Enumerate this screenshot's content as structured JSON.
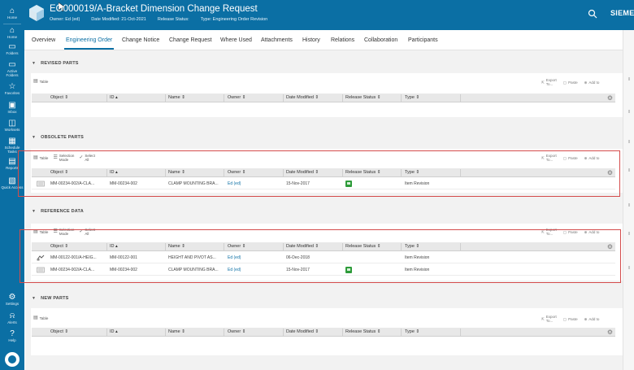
{
  "header": {
    "title": "EO000019/A-Bracket Dimension Change Request",
    "owner": "Owner: Ed (ed)",
    "date_modified": "Date Modified: 21-Oct-2021",
    "release_status": "Release Status:",
    "type": "Type: Engineering Order Revision",
    "brand": "SIEMENS"
  },
  "leftnav": {
    "items": [
      {
        "label": "Home",
        "icon": "home-icon"
      },
      {
        "label": "Home",
        "icon": "home-icon"
      },
      {
        "label": "Folders",
        "icon": "folder-icon"
      },
      {
        "label": "Active\nFolders",
        "icon": "folder-icon"
      },
      {
        "label": "Favorites",
        "icon": "star-icon"
      },
      {
        "label": "Inbox",
        "icon": "inbox-icon"
      },
      {
        "label": "Worksets",
        "icon": "workset-icon"
      },
      {
        "label": "Schedule\nTasks",
        "icon": "schedule-icon"
      },
      {
        "label": "Reports",
        "icon": "report-icon"
      },
      {
        "label": "Quick Access",
        "icon": "quick-access-icon"
      }
    ],
    "bottom_items": [
      {
        "label": "Settings",
        "icon": "gear-icon"
      },
      {
        "label": "Alerts",
        "icon": "bell-icon"
      },
      {
        "label": "Help",
        "icon": "help-icon"
      }
    ]
  },
  "tabs": [
    {
      "label": "Overview"
    },
    {
      "label": "Engineering Order"
    },
    {
      "label": "Change Notice"
    },
    {
      "label": "Change Request"
    },
    {
      "label": "Where Used"
    },
    {
      "label": "Attachments"
    },
    {
      "label": "History"
    },
    {
      "label": "Relations"
    },
    {
      "label": "Collaboration"
    },
    {
      "label": "Participants"
    }
  ],
  "columns": [
    "Object",
    "ID",
    "Name",
    "Owner",
    "Date Modified",
    "Release Status",
    "Type"
  ],
  "toolbar": {
    "table": "Table",
    "selection_mode": "Selection\nMode",
    "select_all": "Select\nAll",
    "export": "Export\nTo...",
    "paste": "Paste",
    "add_to": "Add to"
  },
  "sections": {
    "revised": {
      "title": "REVISED PARTS"
    },
    "obsolete": {
      "title": "OBSOLETE PARTS",
      "rows": [
        {
          "object": "MM-00234-002/A-CLA...",
          "id": "MM-00234-002",
          "name": "CLAMP MOUNTING BRA...",
          "owner": "Ed (ed)",
          "date": "15-Nov-2017",
          "type": "Item Revision"
        }
      ]
    },
    "reference": {
      "title": "REFERENCE DATA",
      "rows": [
        {
          "object": "MM-00122-001/A-HEIG...",
          "id": "MM-00122-001",
          "name": "HEIGHT AND PIVOT AS...",
          "owner": "Ed (ed)",
          "date": "06-Dec-2018",
          "type": "Item Revision"
        },
        {
          "object": "MM-00234-002/A-CLA...",
          "id": "MM-00234-002",
          "name": "CLAMP MOUNTING BRA...",
          "owner": "Ed (ed)",
          "date": "15-Nov-2017",
          "type": "Item Revision"
        }
      ]
    },
    "new": {
      "title": "NEW PARTS"
    }
  }
}
